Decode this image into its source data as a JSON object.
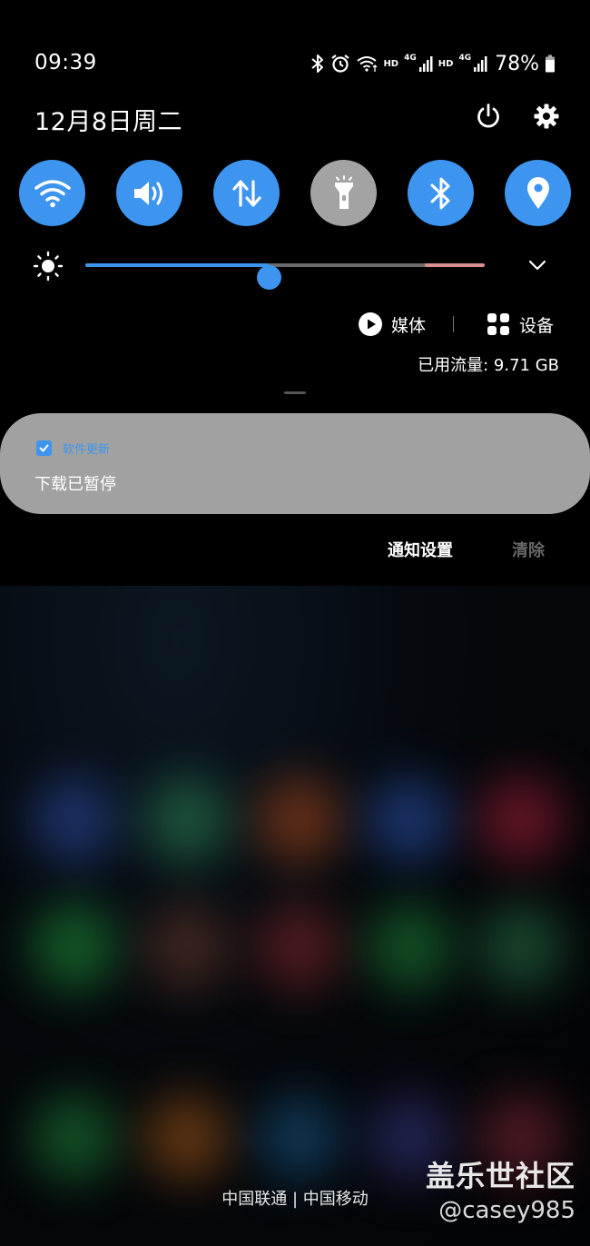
{
  "status_bar": {
    "time": "09:39",
    "hd_label_1": "HD",
    "net_1": "4G",
    "hd_label_2": "HD",
    "net_2": "4G",
    "battery": "78%"
  },
  "header": {
    "date": "12月8日周二"
  },
  "quick_settings": {
    "tiles": [
      {
        "name": "wifi",
        "active": true
      },
      {
        "name": "sound",
        "active": true
      },
      {
        "name": "mobile-data",
        "active": true
      },
      {
        "name": "flashlight",
        "active": false
      },
      {
        "name": "bluetooth",
        "active": true
      },
      {
        "name": "location",
        "active": true
      }
    ],
    "brightness_level": 0.46
  },
  "media_row": {
    "media_label": "媒体",
    "devices_label": "设备"
  },
  "data_usage": "已用流量: 9.71 GB",
  "notification": {
    "app_name": "软件更新",
    "body": "下载已暂停"
  },
  "notification_actions": {
    "settings_label": "通知设置",
    "clear_label": "清除"
  },
  "carrier": "中国联通 | 中国移动",
  "watermark": {
    "site": "盖乐世社区",
    "user": "@casey985"
  },
  "colors": {
    "accent": "#3d95ef",
    "tile_off": "#a3a3a3",
    "notification_bg": "#a1a1a1"
  }
}
